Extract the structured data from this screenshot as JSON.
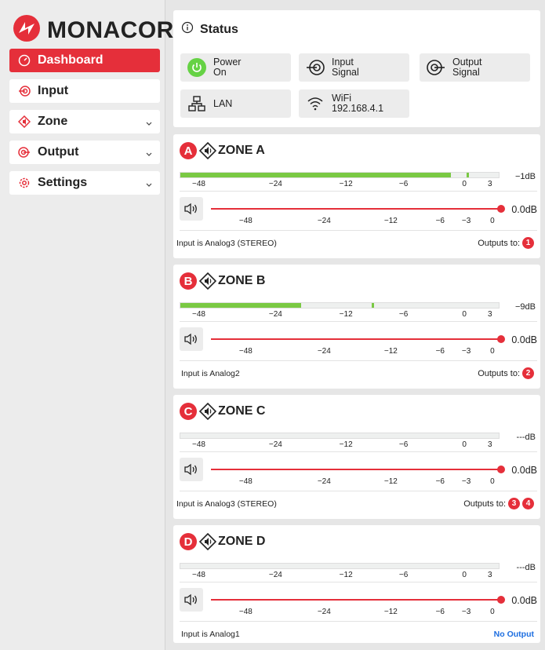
{
  "brand": {
    "name": "MONACOR"
  },
  "nav": {
    "dashboard": "Dashboard",
    "input": "Input",
    "zone": "Zone",
    "output": "Output",
    "settings": "Settings"
  },
  "status": {
    "title": "Status",
    "power": {
      "label": "Power",
      "value": "On"
    },
    "input_signal": {
      "label": "Input",
      "value": "Signal"
    },
    "output_signal": {
      "label": "Output",
      "value": "Signal"
    },
    "lan": {
      "label": "LAN"
    },
    "wifi": {
      "label": "WiFi",
      "value": "192.168.4.1"
    }
  },
  "meter_scale": [
    "−48",
    "−24",
    "−12",
    "−6",
    "0",
    "3"
  ],
  "volume_scale": [
    "−48",
    "−24",
    "−12",
    "−6",
    "−3",
    "0"
  ],
  "outputs_label": "Outputs to:",
  "zones": [
    {
      "letter": "A",
      "name": "ZONE A",
      "meter_db": "−1dB",
      "level": 0.85,
      "peak": 0.9,
      "volume": "0.0dB",
      "input": "Input is Analog3 (STEREO)",
      "outputs": [
        "1"
      ],
      "no_output": ""
    },
    {
      "letter": "B",
      "name": "ZONE B",
      "meter_db": "−9dB",
      "level": 0.38,
      "peak": 0.6,
      "volume": "0.0dB",
      "input": "Input is Analog2",
      "outputs": [
        "2"
      ],
      "no_output": ""
    },
    {
      "letter": "C",
      "name": "ZONE C",
      "meter_db": "---dB",
      "level": 0,
      "peak": 0,
      "volume": "0.0dB",
      "input": "Input is Analog3 (STEREO)",
      "outputs": [
        "3",
        "4"
      ],
      "no_output": ""
    },
    {
      "letter": "D",
      "name": "ZONE D",
      "meter_db": "---dB",
      "level": 0,
      "peak": 0,
      "volume": "0.0dB",
      "input": "Input is Analog1",
      "outputs": [],
      "no_output": "No Output"
    }
  ],
  "colors": {
    "accent": "#e52f3a",
    "meter": "#7ac943",
    "link": "#1d6ee0"
  }
}
